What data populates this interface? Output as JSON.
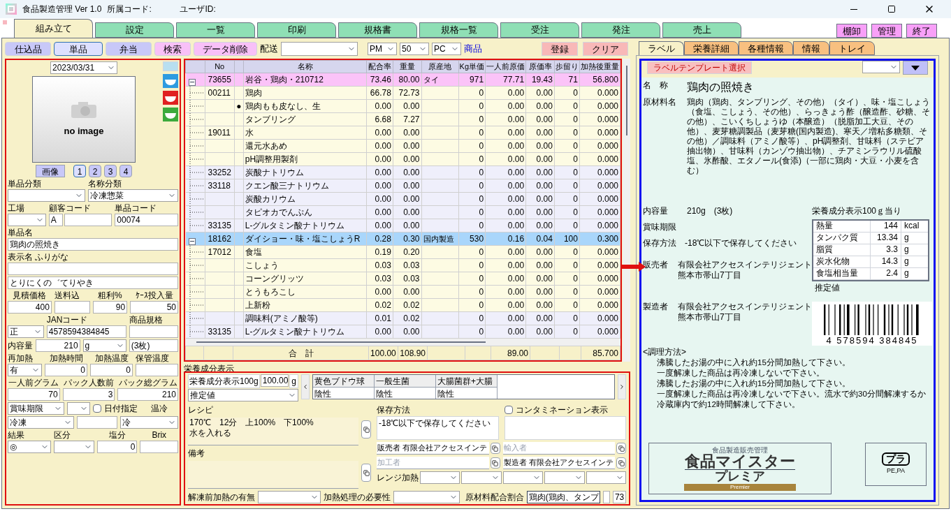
{
  "window": {
    "title": "食品製造管理 Ver 1.0",
    "dept_label": "所属コード:",
    "user_label": "ユーザID:"
  },
  "main_tabs": [
    {
      "label": "組み立て",
      "selected": true
    },
    {
      "label": "設定",
      "selected": false
    },
    {
      "label": "一覧",
      "selected": false
    },
    {
      "label": "印刷",
      "selected": false
    },
    {
      "label": "規格書",
      "selected": false
    },
    {
      "label": "規格一覧",
      "selected": false
    },
    {
      "label": "受注",
      "selected": false
    },
    {
      "label": "発注",
      "selected": false
    },
    {
      "label": "売上",
      "selected": false
    }
  ],
  "top_buttons": [
    "棚卸",
    "管理",
    "終了"
  ],
  "toolbar": {
    "buttons": [
      {
        "label": "仕込品",
        "kind": "mode",
        "selected": false
      },
      {
        "label": "単品",
        "kind": "mode",
        "selected": true
      },
      {
        "label": "弁当",
        "kind": "mode",
        "selected": false
      },
      {
        "label": "検索",
        "kind": "action",
        "selected": false
      },
      {
        "label": "データ削除",
        "kind": "action",
        "selected": false
      }
    ],
    "delivery_label": "配送",
    "selects": [
      "PM",
      "50",
      "PC"
    ],
    "link": "商品",
    "actions": [
      "登録",
      "クリア"
    ]
  },
  "left_form": {
    "date": "2023/03/31",
    "image_caption": "no image",
    "image_button": "画像",
    "pages": [
      {
        "label": "1",
        "selected": true
      },
      {
        "label": "2",
        "selected": false
      },
      {
        "label": "3",
        "selected": false
      },
      {
        "label": "4",
        "selected": false
      }
    ],
    "rows": [
      {
        "cells": [
          {
            "label": "単品分類",
            "kind": "select"
          },
          {
            "label": "名称分類",
            "kind": "select",
            "value": "冷凍惣菜"
          }
        ]
      },
      {
        "cells": [
          {
            "label": "工場",
            "kind": "select"
          },
          {
            "label": "顧客コード",
            "kind": "code",
            "value": "A"
          },
          {
            "label": "単品コード",
            "kind": "input",
            "value": "00074"
          }
        ]
      },
      {
        "cells": [
          {
            "label": "単品名",
            "kind": "input",
            "value": "鶏肉の照焼き"
          }
        ]
      },
      {
        "cells": [
          {
            "label": "表示名 ふりがな",
            "kind": "input"
          }
        ]
      },
      {
        "cells": [
          {
            "kind": "input",
            "value": "とりにくの゛てりやき"
          }
        ]
      },
      {
        "cells": [
          {
            "label": "見積価格",
            "kind": "number",
            "value": "400"
          },
          {
            "label": "送料込",
            "kind": "input"
          },
          {
            "label": "粗利%",
            "kind": "number",
            "value": "90"
          },
          {
            "label": "ｹｰｽ投入量",
            "kind": "number",
            "value": "50"
          }
        ]
      },
      {
        "cells": [
          {
            "kind": "select",
            "value": "正"
          },
          {
            "label": "JANコード",
            "kind": "input",
            "value": "4578594384845"
          },
          {
            "label": "商品規格",
            "kind": "input"
          }
        ]
      },
      {
        "cells": [
          {
            "label": "内容量",
            "kind": "number",
            "value": "210"
          },
          {
            "kind": "select",
            "value": "g"
          },
          {
            "kind": "input",
            "value": "(3枚)"
          }
        ]
      },
      {
        "cells": [
          {
            "label": "再加熱",
            "kind": "select",
            "value": "有"
          },
          {
            "label": "加熱時間",
            "kind": "number",
            "value": "0"
          },
          {
            "label": "加熱温度",
            "kind": "number",
            "value": "0"
          },
          {
            "label": "保管温度",
            "kind": "input"
          }
        ]
      },
      {
        "cells": [
          {
            "label": "一人前グラム",
            "kind": "number",
            "value": "70"
          },
          {
            "label": "パック人数前",
            "kind": "number",
            "value": "3"
          },
          {
            "label": "パック総グラム",
            "kind": "number",
            "value": "210"
          }
        ]
      },
      {
        "cells": [
          {
            "kind": "select",
            "value": "賞味期限"
          },
          {
            "kind": "select"
          },
          {
            "kind": "checkbox",
            "value": "日付指定",
            "checked": false
          },
          {
            "kind": "text",
            "value": "温冷"
          }
        ]
      },
      {
        "cells": [
          {
            "kind": "select",
            "value": "冷凍"
          },
          {
            "kind": "input"
          },
          {
            "kind": "select",
            "value": "冷"
          }
        ]
      },
      {
        "cells": [
          {
            "label": "結果",
            "kind": "select",
            "value": "◎"
          },
          {
            "label": "区分",
            "kind": "select"
          },
          {
            "label": "塩分",
            "kind": "number",
            "value": "0"
          },
          {
            "label": "Brix",
            "kind": "number"
          }
        ]
      }
    ]
  },
  "table": {
    "columns": [
      "No",
      "名称",
      "配合率",
      "重量",
      "原産地",
      "Kg単価",
      "一人前原価",
      "原価率",
      "歩留り",
      "加熱後重量"
    ],
    "rows": [
      {
        "kind": "parent",
        "expanded": true,
        "selected": false,
        "no": "73655",
        "name": "岩谷・鶏肉・210712",
        "origin": "タイ",
        "values": [
          "73.46",
          "80.00",
          "971",
          "77.71",
          "19.43",
          "71",
          "56.800"
        ]
      },
      {
        "kind": "child",
        "selected": false,
        "additive": false,
        "no": "00211",
        "name": "鶏肉",
        "values": [
          "66.78",
          "72.73",
          "0",
          "0.00",
          "0.00",
          "0",
          "0.000"
        ]
      },
      {
        "kind": "child",
        "selected": false,
        "additive": false,
        "mark": "●",
        "name": "鶏肉もも皮なし、生",
        "values": [
          "0.00",
          "0.00",
          "0",
          "0.00",
          "0.00",
          "0",
          "0.000"
        ]
      },
      {
        "kind": "child",
        "selected": false,
        "additive": false,
        "name": "タンブリング",
        "values": [
          "6.68",
          "7.27",
          "0",
          "0.00",
          "0.00",
          "0",
          "0.000"
        ]
      },
      {
        "kind": "child",
        "selected": false,
        "additive": false,
        "no": "19011",
        "name": "水",
        "values": [
          "0.00",
          "0.00",
          "0",
          "0.00",
          "0.00",
          "0",
          "0.000"
        ]
      },
      {
        "kind": "child",
        "selected": false,
        "additive": false,
        "name": "還元水あめ",
        "values": [
          "0.00",
          "0.00",
          "0",
          "0.00",
          "0.00",
          "0",
          "0.000"
        ]
      },
      {
        "kind": "child",
        "selected": false,
        "additive": false,
        "name": "pH調整用製剤",
        "values": [
          "0.00",
          "0.00",
          "0",
          "0.00",
          "0.00",
          "0",
          "0.000"
        ]
      },
      {
        "kind": "child",
        "selected": false,
        "additive": true,
        "no": "33252",
        "name": "炭酸ナトリウム",
        "values": [
          "0.00",
          "0.00",
          "0",
          "0.00",
          "0.00",
          "0",
          "0.000"
        ]
      },
      {
        "kind": "child",
        "selected": false,
        "additive": true,
        "no": "33118",
        "name": "クエン酸三ナトリウム",
        "values": [
          "0.00",
          "0.00",
          "0",
          "0.00",
          "0.00",
          "0",
          "0.000"
        ]
      },
      {
        "kind": "child",
        "selected": false,
        "additive": true,
        "name": "炭酸カリウム",
        "values": [
          "0.00",
          "0.00",
          "0",
          "0.00",
          "0.00",
          "0",
          "0.000"
        ]
      },
      {
        "kind": "child",
        "selected": false,
        "additive": true,
        "name": "タピオカでんぷん",
        "values": [
          "0.00",
          "0.00",
          "0",
          "0.00",
          "0.00",
          "0",
          "0.000"
        ]
      },
      {
        "kind": "child",
        "selected": false,
        "additive": true,
        "no": "33135",
        "name": "L-グルタミン酸ナトリウム",
        "values": [
          "0.00",
          "0.00",
          "0",
          "0.00",
          "0.00",
          "0",
          "0.000"
        ]
      },
      {
        "kind": "parent",
        "expanded": true,
        "selected": true,
        "no": "18162",
        "name": "ダイショー・味・塩こしょうR",
        "origin": "国内製造",
        "values": [
          "0.28",
          "0.30",
          "530",
          "0.16",
          "0.04",
          "100",
          "0.300"
        ]
      },
      {
        "kind": "child",
        "selected": false,
        "additive": false,
        "no": "17012",
        "name": "食塩",
        "values": [
          "0.19",
          "0.20",
          "0",
          "0.00",
          "0.00",
          "0",
          "0.000"
        ]
      },
      {
        "kind": "child",
        "selected": false,
        "additive": false,
        "name": "こしょう",
        "values": [
          "0.03",
          "0.03",
          "0",
          "0.00",
          "0.00",
          "0",
          "0.000"
        ]
      },
      {
        "kind": "child",
        "selected": false,
        "additive": false,
        "name": "コーングリッツ",
        "values": [
          "0.03",
          "0.03",
          "0",
          "0.00",
          "0.00",
          "0",
          "0.000"
        ]
      },
      {
        "kind": "child",
        "selected": false,
        "additive": false,
        "name": "とうもろこし",
        "values": [
          "0.00",
          "0.00",
          "0",
          "0.00",
          "0.00",
          "0",
          "0.000"
        ]
      },
      {
        "kind": "child",
        "selected": false,
        "additive": false,
        "name": "上新粉",
        "values": [
          "0.02",
          "0.02",
          "0",
          "0.00",
          "0.00",
          "0",
          "0.000"
        ]
      },
      {
        "kind": "child",
        "selected": false,
        "additive": true,
        "name": "調味料(アミノ酸等)",
        "values": [
          "0.01",
          "0.02",
          "0",
          "0.00",
          "0.00",
          "0",
          "0.000"
        ]
      },
      {
        "kind": "child",
        "selected": false,
        "additive": true,
        "no": "33135",
        "name": "L-グルタミン酸ナトリウム",
        "values": [
          "0.00",
          "0.00",
          "0",
          "0.00",
          "0.00",
          "0",
          "0.000"
        ]
      }
    ],
    "footer": {
      "label": "合　計",
      "ratio": "100.00",
      "weight": "108.90",
      "unit_cost": "89.00",
      "cooked_weight": "85.700"
    }
  },
  "bottom": {
    "section_title": "栄養成分表示",
    "basis_label": "栄養成分表示100g",
    "basis_value": "100.00",
    "basis_unit": "g",
    "estimate": "推定値",
    "microbes": [
      {
        "name": "黄色ブドウ球",
        "result": "陰性"
      },
      {
        "name": "一般生菌",
        "result": "陰性"
      },
      {
        "name": "大腸菌群+大腸",
        "result": "陰性"
      }
    ],
    "recipe_label": "レシピ",
    "recipe": "170℃　12分　上100%　下100%\n水を入れる",
    "notes_label": "備考",
    "storage_label": "保存方法",
    "storage": "-18℃以下で保存してください",
    "contamination": {
      "label": "コンタミネーション表示",
      "checked": false
    },
    "parties": [
      {
        "label": "販売者",
        "value": "有限会社アクセスインテ"
      },
      {
        "label": "輸入者"
      },
      {
        "label": "加工者"
      },
      {
        "label": "製造者",
        "value": "有限会社アクセスインテ"
      }
    ],
    "range_label": "レンジ加熱",
    "thaw_label": "解凍前加熱の有無",
    "heat_label": "加熱処理の必要性",
    "ratio_label": "原材料配合割合",
    "ratio_value": "鶏肉(鶏肉、タンプ",
    "ratio_percent": "73"
  },
  "right": {
    "tabs": [
      {
        "label": "ラベル",
        "selected": true
      },
      {
        "label": "栄養詳細",
        "selected": false
      },
      {
        "label": "各種情報",
        "selected": false
      },
      {
        "label": "情報",
        "selected": false
      },
      {
        "label": "トレイ",
        "selected": false
      }
    ],
    "template_button": "ラベルテンプレート選択",
    "label": {
      "name_label": "名　称",
      "name": "鶏肉の照焼き",
      "ingredients_label": "原材料名",
      "ingredients": "鶏肉（鶏肉、タンブリング、その他）（タイ）、味・塩こしょう（食塩、こしょう、その他）、らっきょう酢（醸造酢、砂糖、その他）、こいくちしょうゆ（本醸造）（脱脂加工大豆、その他）、麦芽糖調製品（麦芽糖(国内製造)、寒天／増粘多糖類、その他）／調味料（アミノ酸等）、pH調整剤、甘味料（ステビア抽出物）、甘味料（カンゾウ抽出物）、チアミンラウリル硫酸塩、氷酢酸、エタノール(食添)（一部に鶏肉・大豆・小麦を含む）",
      "content_label": "内容量",
      "content": "210g　(3枚)",
      "expiry_label": "賞味期限",
      "storage_label": "保存方法",
      "storage": "-18℃以下で保存してください",
      "nutrition_title": "栄養成分表示100ｇ当り",
      "nutrition": [
        {
          "name": "熱量",
          "value": "144",
          "unit": "kcal"
        },
        {
          "name": "タンパク質",
          "value": "13.34",
          "unit": "g"
        },
        {
          "name": "脂質",
          "value": "3.3",
          "unit": "g"
        },
        {
          "name": "炭水化物",
          "value": "14.3",
          "unit": "g"
        },
        {
          "name": "食塩相当量",
          "value": "2.4",
          "unit": "g"
        }
      ],
      "nutrition_note": "推定値",
      "seller_label": "販売者",
      "seller": "有限会社アクセスインテリジェント",
      "seller_address": "熊本市帯山7丁目",
      "maker_label": "製造者",
      "maker": "有限会社アクセスインテリジェント",
      "maker_address": "熊本市帯山7丁目",
      "barcode_digits": "4 578594 384845",
      "cooking_title": "<調理方法>",
      "cooking": [
        "沸騰したお湯の中に入れ約15分間加熱して下さい。",
        "一度解凍した商品は再冷凍しないで下さい。",
        "沸騰したお湯の中に入れ約15分間加熱して下さい。",
        "一度解凍した商品は再冷凍しないで下さい。流水で約30分間解凍するか",
        "冷蔵庫内で約12時間解凍して下さい。"
      ],
      "logo": {
        "subtitle": "食品製造販売管理",
        "title": "食品マイスター",
        "title2": "プレミア",
        "badge": "Premier"
      },
      "recycle": {
        "symbol": "プラ",
        "materials": "PE,PA"
      }
    }
  }
}
